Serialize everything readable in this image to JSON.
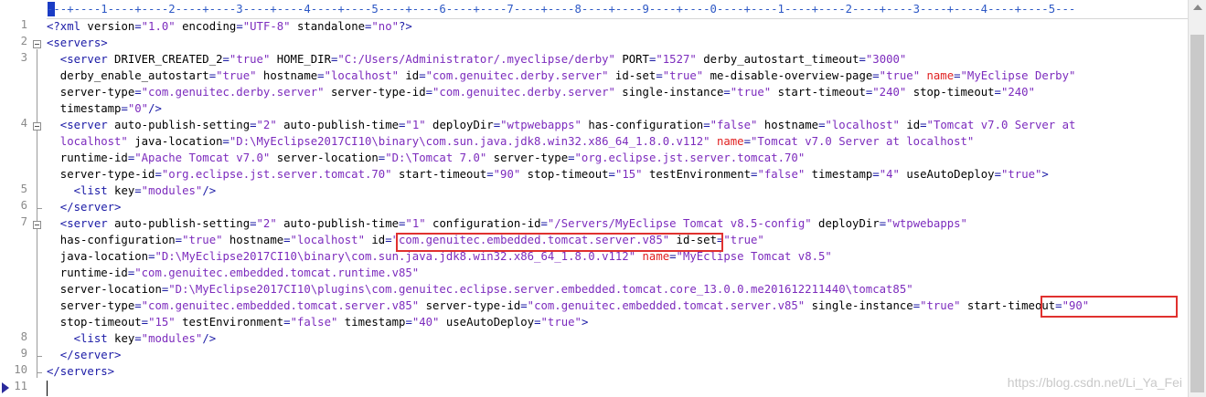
{
  "ruler": {
    "text": "---+----1----+----2----+----3----+----4----+----5----+----6----+----7----+----8----+----9----+----0----+----1----+----2----+----3----+----4----+----5---"
  },
  "line_numbers": [
    "1",
    "2",
    "3",
    "4",
    "5",
    "6",
    "7",
    "8",
    "9",
    "10",
    "11"
  ],
  "lines": [
    [
      [
        "pi",
        "<?xml "
      ],
      [
        "attr",
        "version"
      ],
      [
        "eq",
        "="
      ],
      [
        "val",
        "\"1.0\""
      ],
      [
        "attr",
        " encoding"
      ],
      [
        "eq",
        "="
      ],
      [
        "val",
        "\"UTF-8\""
      ],
      [
        "attr",
        " standalone"
      ],
      [
        "eq",
        "="
      ],
      [
        "val",
        "\"no\""
      ],
      [
        "pi",
        "?>"
      ]
    ],
    [
      [
        "tag",
        "<servers>"
      ]
    ],
    [
      [
        "tag",
        "  <server "
      ],
      [
        "attr",
        "DRIVER_CREATED_2"
      ],
      [
        "eq",
        "="
      ],
      [
        "val",
        "\"true\""
      ],
      [
        "attr",
        " HOME_DIR"
      ],
      [
        "eq",
        "="
      ],
      [
        "val",
        "\"C:/Users/Administrator/.myeclipse/derby\""
      ],
      [
        "attr",
        " PORT"
      ],
      [
        "eq",
        "="
      ],
      [
        "val",
        "\"1527\""
      ],
      [
        "attr",
        " derby_autostart_timeout"
      ],
      [
        "eq",
        "="
      ],
      [
        "val",
        "\"3000\""
      ]
    ],
    [
      [
        "attr",
        "  derby_enable_autostart"
      ],
      [
        "eq",
        "="
      ],
      [
        "val",
        "\"true\""
      ],
      [
        "attr",
        " hostname"
      ],
      [
        "eq",
        "="
      ],
      [
        "val",
        "\"localhost\""
      ],
      [
        "attr",
        " id"
      ],
      [
        "eq",
        "="
      ],
      [
        "val",
        "\"com.genuitec.derby.server\""
      ],
      [
        "attr",
        " id-set"
      ],
      [
        "eq",
        "="
      ],
      [
        "val",
        "\"true\""
      ],
      [
        "attr",
        " me-disable-overview-page"
      ],
      [
        "eq",
        "="
      ],
      [
        "val",
        "\"true\""
      ],
      [
        "redname",
        " name"
      ],
      [
        "eq",
        "="
      ],
      [
        "val",
        "\"MyEclipse Derby\""
      ]
    ],
    [
      [
        "attr",
        "  server-type"
      ],
      [
        "eq",
        "="
      ],
      [
        "val",
        "\"com.genuitec.derby.server\""
      ],
      [
        "attr",
        " server-type-id"
      ],
      [
        "eq",
        "="
      ],
      [
        "val",
        "\"com.genuitec.derby.server\""
      ],
      [
        "attr",
        " single-instance"
      ],
      [
        "eq",
        "="
      ],
      [
        "val",
        "\"true\""
      ],
      [
        "attr",
        " start-timeout"
      ],
      [
        "eq",
        "="
      ],
      [
        "val",
        "\"240\""
      ],
      [
        "attr",
        " stop-timeout"
      ],
      [
        "eq",
        "="
      ],
      [
        "val",
        "\"240\""
      ]
    ],
    [
      [
        "attr",
        "  timestamp"
      ],
      [
        "eq",
        "="
      ],
      [
        "val",
        "\"0\""
      ],
      [
        "tag",
        "/>"
      ]
    ],
    [
      [
        "tag",
        "  <server "
      ],
      [
        "attr",
        "auto-publish-setting"
      ],
      [
        "eq",
        "="
      ],
      [
        "val",
        "\"2\""
      ],
      [
        "attr",
        " auto-publish-time"
      ],
      [
        "eq",
        "="
      ],
      [
        "val",
        "\"1\""
      ],
      [
        "attr",
        " deployDir"
      ],
      [
        "eq",
        "="
      ],
      [
        "val",
        "\"wtpwebapps\""
      ],
      [
        "attr",
        " has-configuration"
      ],
      [
        "eq",
        "="
      ],
      [
        "val",
        "\"false\""
      ],
      [
        "attr",
        " hostname"
      ],
      [
        "eq",
        "="
      ],
      [
        "val",
        "\"localhost\""
      ],
      [
        "attr",
        " id"
      ],
      [
        "eq",
        "="
      ],
      [
        "val",
        "\"Tomcat v7.0 Server at"
      ]
    ],
    [
      [
        "val",
        "  localhost\""
      ],
      [
        "attr",
        " java-location"
      ],
      [
        "eq",
        "="
      ],
      [
        "val",
        "\"D:\\MyEclipse2017CI10\\binary\\com.sun.java.jdk8.win32.x86_64_1.8.0.v112\""
      ],
      [
        "redname",
        " name"
      ],
      [
        "eq",
        "="
      ],
      [
        "val",
        "\"Tomcat v7.0 Server at localhost\""
      ]
    ],
    [
      [
        "attr",
        "  runtime-id"
      ],
      [
        "eq",
        "="
      ],
      [
        "val",
        "\"Apache Tomcat v7.0\""
      ],
      [
        "attr",
        " server-location"
      ],
      [
        "eq",
        "="
      ],
      [
        "val",
        "\"D:\\Tomcat 7.0\""
      ],
      [
        "attr",
        " server-type"
      ],
      [
        "eq",
        "="
      ],
      [
        "val",
        "\"org.eclipse.jst.server.tomcat.70\""
      ]
    ],
    [
      [
        "attr",
        "  server-type-id"
      ],
      [
        "eq",
        "="
      ],
      [
        "val",
        "\"org.eclipse.jst.server.tomcat.70\""
      ],
      [
        "attr",
        " start-timeout"
      ],
      [
        "eq",
        "="
      ],
      [
        "val",
        "\"90\""
      ],
      [
        "attr",
        " stop-timeout"
      ],
      [
        "eq",
        "="
      ],
      [
        "val",
        "\"15\""
      ],
      [
        "attr",
        " testEnvironment"
      ],
      [
        "eq",
        "="
      ],
      [
        "val",
        "\"false\""
      ],
      [
        "attr",
        " timestamp"
      ],
      [
        "eq",
        "="
      ],
      [
        "val",
        "\"4\""
      ],
      [
        "attr",
        " useAutoDeploy"
      ],
      [
        "eq",
        "="
      ],
      [
        "val",
        "\"true\""
      ],
      [
        "tag",
        ">"
      ]
    ],
    [
      [
        "tag",
        "    <list "
      ],
      [
        "attr",
        "key"
      ],
      [
        "eq",
        "="
      ],
      [
        "val",
        "\"modules\""
      ],
      [
        "tag",
        "/>"
      ]
    ],
    [
      [
        "tag",
        "  </server>"
      ]
    ],
    [
      [
        "tag",
        "  <server "
      ],
      [
        "attr",
        "auto-publish-setting"
      ],
      [
        "eq",
        "="
      ],
      [
        "val",
        "\"2\""
      ],
      [
        "attr",
        " auto-publish-time"
      ],
      [
        "eq",
        "="
      ],
      [
        "val",
        "\"1\""
      ],
      [
        "attr",
        " configuration-id"
      ],
      [
        "eq",
        "="
      ],
      [
        "val",
        "\"/Servers/MyEclipse Tomcat v8.5-config\""
      ],
      [
        "attr",
        " deployDir"
      ],
      [
        "eq",
        "="
      ],
      [
        "val",
        "\"wtpwebapps\""
      ]
    ],
    [
      [
        "attr",
        "  has-configuration"
      ],
      [
        "eq",
        "="
      ],
      [
        "val",
        "\"true\""
      ],
      [
        "attr",
        " hostname"
      ],
      [
        "eq",
        "="
      ],
      [
        "val",
        "\"localhost\""
      ],
      [
        "attr",
        " id"
      ],
      [
        "eq",
        "="
      ],
      [
        "val",
        "\"com.genuitec.embedded.tomcat.server.v85\""
      ],
      [
        "attr",
        " id-set"
      ],
      [
        "eq",
        "="
      ],
      [
        "val",
        "\"true\""
      ]
    ],
    [
      [
        "attr",
        "  java-location"
      ],
      [
        "eq",
        "="
      ],
      [
        "val",
        "\"D:\\MyEclipse2017CI10\\binary\\com.sun.java.jdk8.win32.x86_64_1.8.0.v112\""
      ],
      [
        "redname",
        " name"
      ],
      [
        "eq",
        "="
      ],
      [
        "val",
        "\"MyEclipse Tomcat v8.5\""
      ]
    ],
    [
      [
        "attr",
        "  runtime-id"
      ],
      [
        "eq",
        "="
      ],
      [
        "val",
        "\"com.genuitec.embedded.tomcat.runtime.v85\""
      ]
    ],
    [
      [
        "attr",
        "  server-location"
      ],
      [
        "eq",
        "="
      ],
      [
        "val",
        "\"D:\\MyEclipse2017CI10\\plugins\\com.genuitec.eclipse.server.embedded.tomcat.core_13.0.0.me201612211440\\tomcat85\""
      ]
    ],
    [
      [
        "attr",
        "  server-type"
      ],
      [
        "eq",
        "="
      ],
      [
        "val",
        "\"com.genuitec.embedded.tomcat.server.v85\""
      ],
      [
        "attr",
        " server-type-id"
      ],
      [
        "eq",
        "="
      ],
      [
        "val",
        "\"com.genuitec.embedded.tomcat.server.v85\""
      ],
      [
        "attr",
        " single-instance"
      ],
      [
        "eq",
        "="
      ],
      [
        "val",
        "\"true\""
      ],
      [
        "attr",
        " start-timeout"
      ],
      [
        "eq",
        "="
      ],
      [
        "val",
        "\"90\""
      ]
    ],
    [
      [
        "attr",
        "  stop-timeout"
      ],
      [
        "eq",
        "="
      ],
      [
        "val",
        "\"15\""
      ],
      [
        "attr",
        " testEnvironment"
      ],
      [
        "eq",
        "="
      ],
      [
        "val",
        "\"false\""
      ],
      [
        "attr",
        " timestamp"
      ],
      [
        "eq",
        "="
      ],
      [
        "val",
        "\"40\""
      ],
      [
        "attr",
        " useAutoDeploy"
      ],
      [
        "eq",
        "="
      ],
      [
        "val",
        "\"true\""
      ],
      [
        "tag",
        ">"
      ]
    ],
    [
      [
        "tag",
        "    <list "
      ],
      [
        "attr",
        "key"
      ],
      [
        "eq",
        "="
      ],
      [
        "val",
        "\"modules\""
      ],
      [
        "tag",
        "/>"
      ]
    ],
    [
      [
        "tag",
        "  </server>"
      ]
    ],
    [
      [
        "tag",
        "</servers>"
      ]
    ],
    [
      [
        "attr",
        ""
      ]
    ]
  ],
  "watermark": "https://blog.csdn.net/Li_Ya_Fei"
}
